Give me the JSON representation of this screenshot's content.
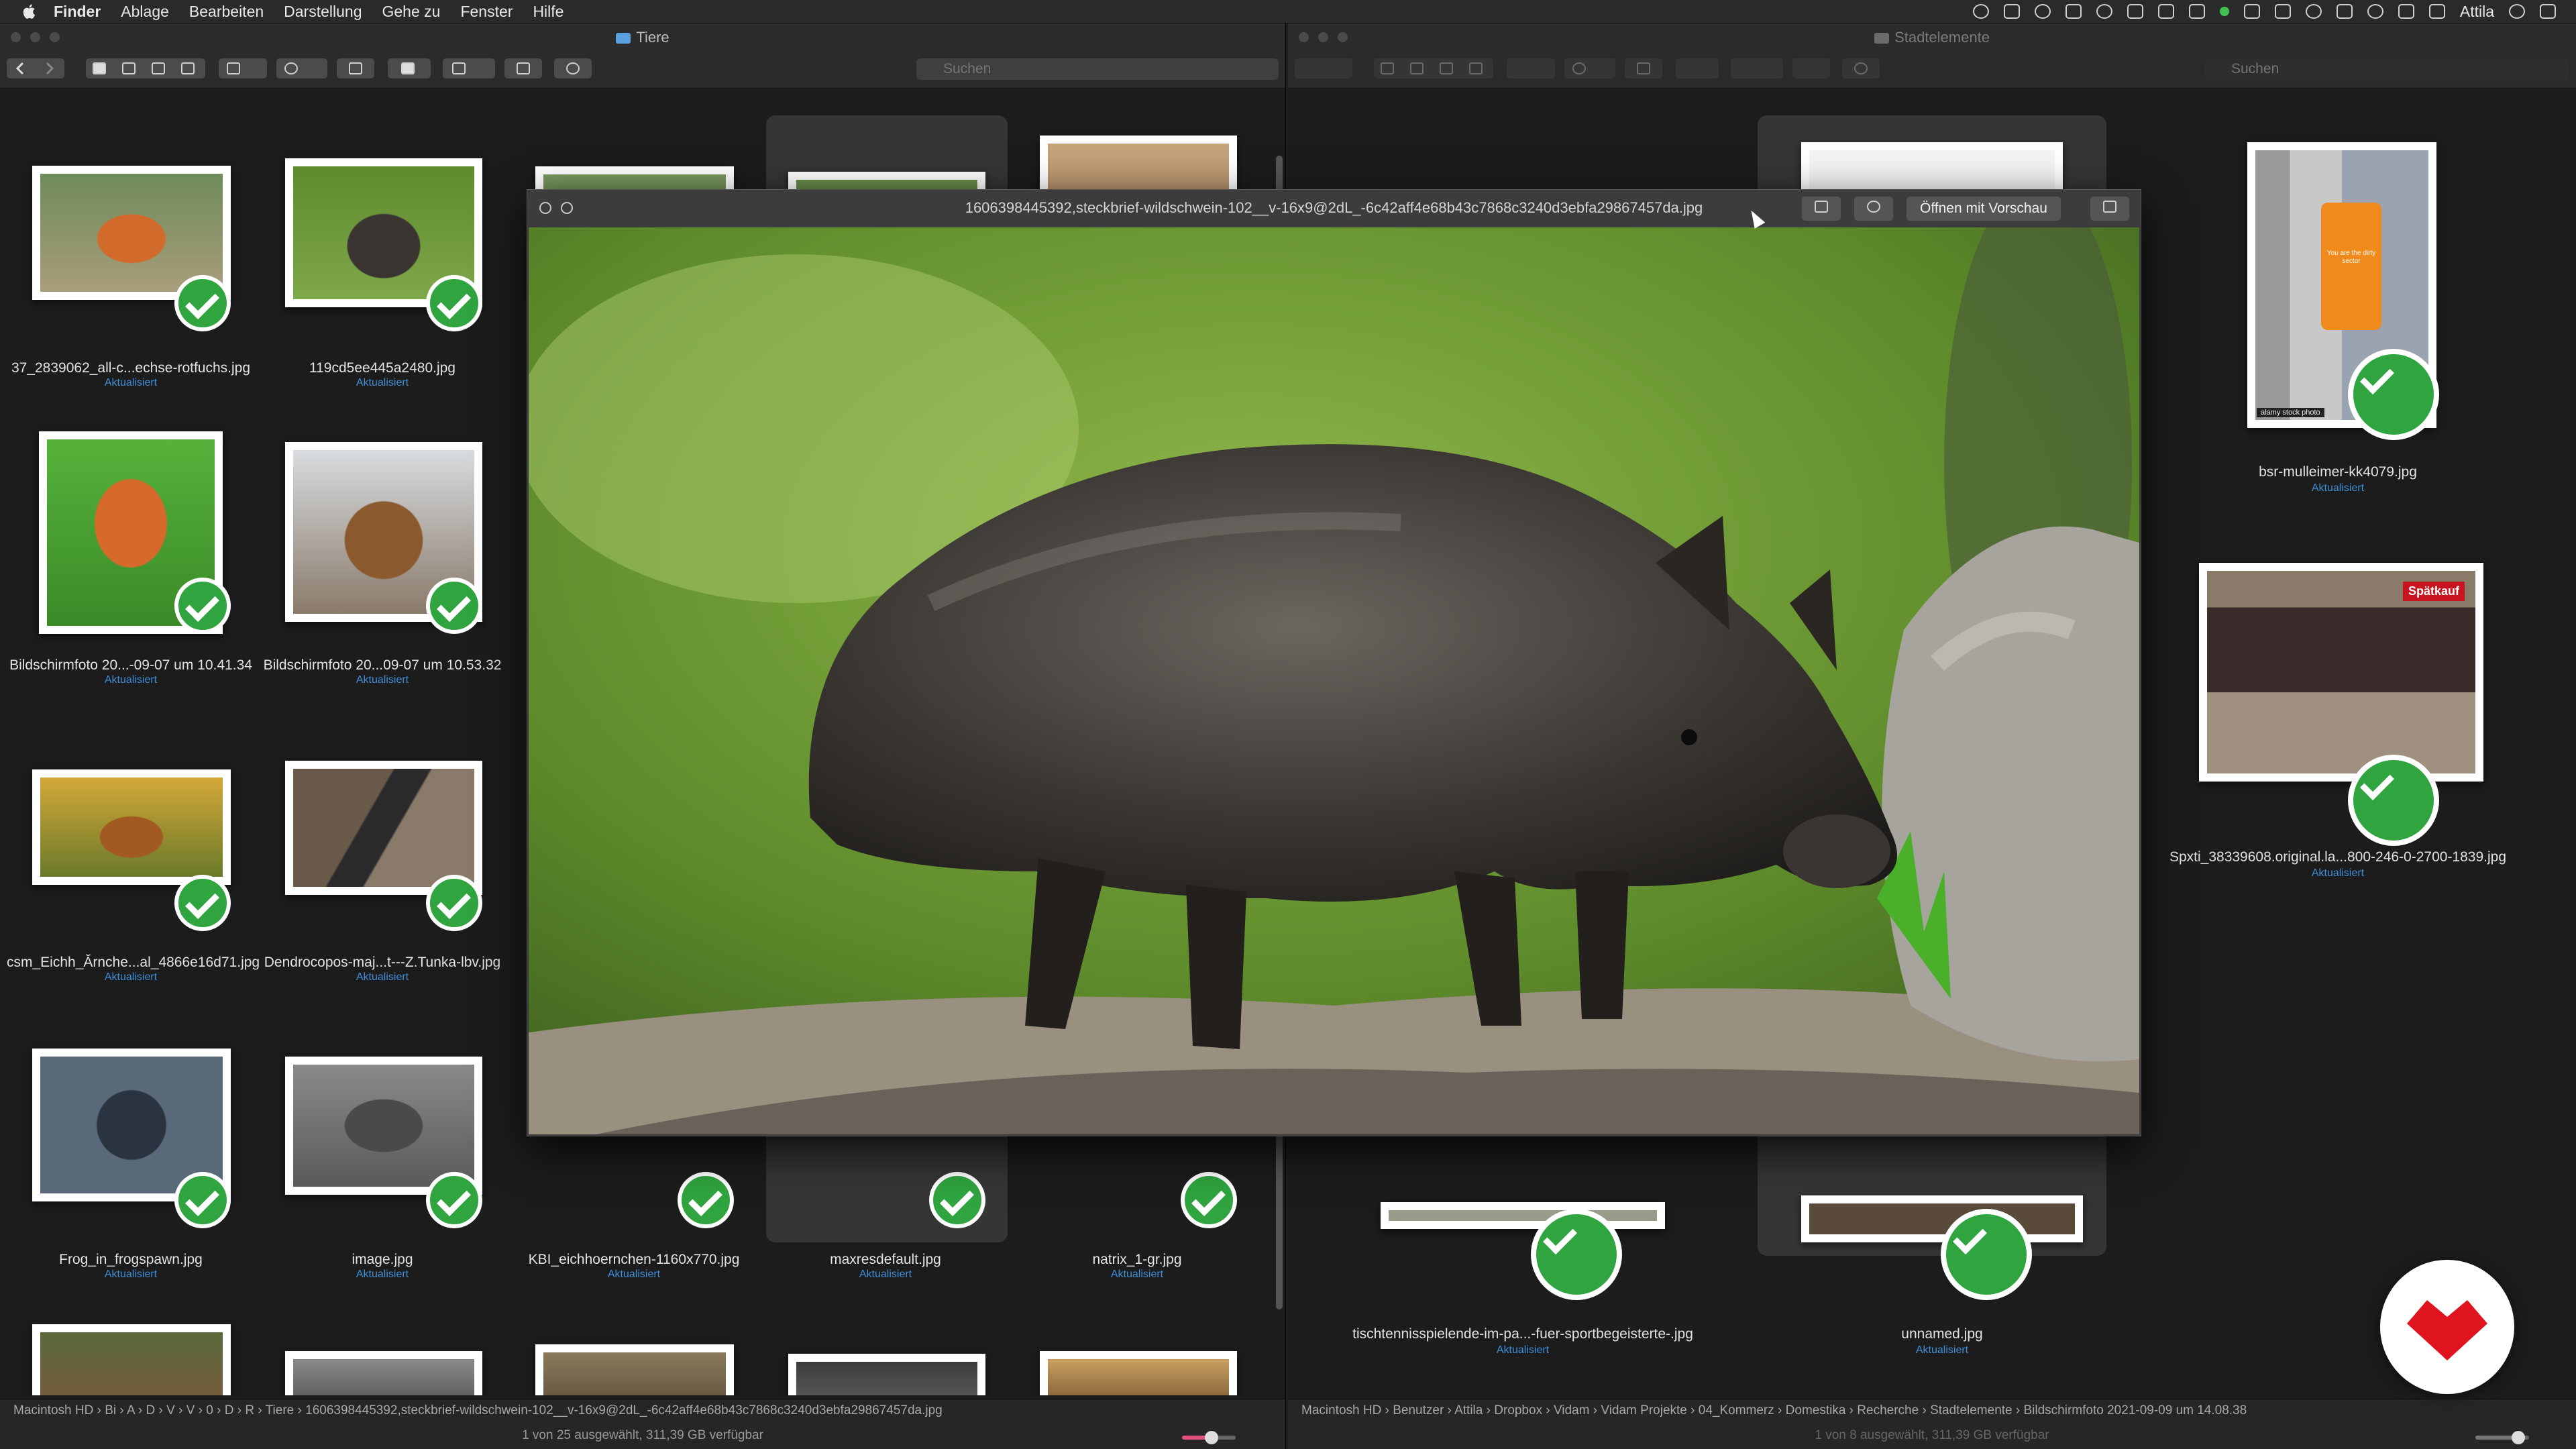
{
  "menubar": {
    "items": [
      "Finder",
      "Ablage",
      "Bearbeiten",
      "Darstellung",
      "Gehe zu",
      "Fenster",
      "Hilfe"
    ],
    "user": "Attila"
  },
  "left_window": {
    "title": "Tiere",
    "search_placeholder": "Suchen",
    "items": [
      {
        "name": "37_2839062_all-c...echse-rotfuchs.jpg",
        "status": "Aktualisiert"
      },
      {
        "name": "119cd5ee445a2480.jpg",
        "status": "Aktualisiert"
      },
      {
        "name": "Bildschirmfoto 20...-09-07 um 10.41.34",
        "status": "Aktualisiert"
      },
      {
        "name": "Bildschirmfoto 20...09-07 um 10.53.32",
        "status": "Aktualisiert"
      },
      {
        "name": "csm_Eichh_Ărnche...al_4866e16d71.jpg",
        "status": "Aktualisiert"
      },
      {
        "name": "Dendrocopos-maj...t---Z.Tunka-lbv.jpg",
        "status": "Aktualisiert"
      },
      {
        "name": "Frog_in_frogspawn.jpg",
        "status": "Aktualisiert"
      },
      {
        "name": "image.jpg",
        "status": "Aktualisiert"
      },
      {
        "name": "KBI_eichhoernchen-1160x770.jpg",
        "status": "Aktualisiert"
      },
      {
        "name": "maxresdefault.jpg",
        "status": "Aktualisiert"
      },
      {
        "name": "natrix_1-gr.jpg",
        "status": "Aktualisiert"
      }
    ],
    "path": [
      "Macintosh HD",
      "Bi",
      "A",
      "D",
      "V",
      "V",
      "0",
      "D",
      "R",
      "Tiere",
      "1606398445392,steckbrief-wildschwein-102__v-16x9@2dL_-6c42aff4e68b43c7868c3240d3ebfa29867457da.jpg"
    ],
    "status": "1 von 25 ausgewählt, 311,39 GB verfügbar",
    "zoom_level": 0.55
  },
  "right_window": {
    "title": "Stadtelemente",
    "search_placeholder": "Suchen",
    "items": [
      {
        "name": "bsr-mulleimer-kk4079.jpg",
        "status": "Aktualisiert"
      },
      {
        "name": "Spxti_38339608.original.la...800-246-0-2700-1839.jpg",
        "status": "Aktualisiert"
      },
      {
        "name": "tischtennisspielende-im-pa...-fuer-sportbegeisterte-.jpg",
        "status": "Aktualisiert"
      },
      {
        "name": "unnamed.jpg",
        "status": "Aktualisiert"
      }
    ],
    "path": [
      "Macintosh HD",
      "Benutzer",
      "Attila",
      "Dropbox",
      "Vidam",
      "Vidam Projekte",
      "04_Kommerz",
      "Domestika",
      "Recherche",
      "Stadtelemente",
      "Bildschirmfoto 2021-09-09 um 14.08.38"
    ],
    "status": "1 von 8 ausgewählt, 311,39 GB verfügbar",
    "zoom_level": 0.8
  },
  "quicklook": {
    "filename": "1606398445392,steckbrief-wildschwein-102__v-16x9@2dL_-6c42aff4e68b43c7868c3240d3ebfa29867457da.jpg",
    "open_button": "Öffnen mit Vorschau"
  },
  "sign_texts": {
    "bin": "You are the dirty sector",
    "watermark": "alamy stock photo",
    "shop": "Spätkauf"
  },
  "colors": {
    "check_green": "#2fa43f",
    "status_blue": "#3f8ed8",
    "fab_red": "#e0141e"
  }
}
